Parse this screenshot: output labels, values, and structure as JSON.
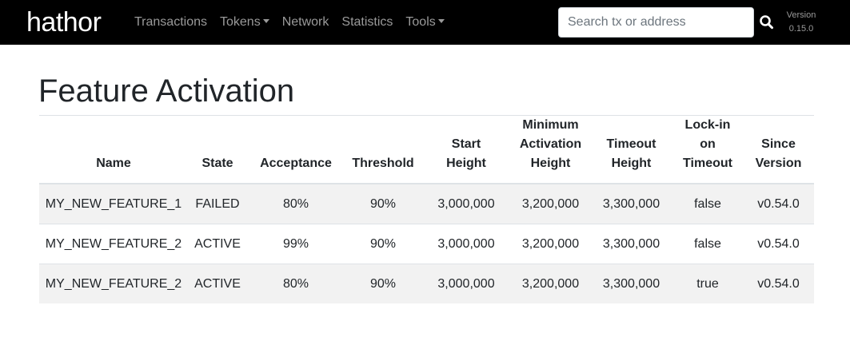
{
  "navbar": {
    "logo_text": "hathor",
    "links": [
      {
        "label": "Transactions",
        "dropdown": false
      },
      {
        "label": "Tokens",
        "dropdown": true
      },
      {
        "label": "Network",
        "dropdown": false
      },
      {
        "label": "Statistics",
        "dropdown": false
      },
      {
        "label": "Tools",
        "dropdown": true
      }
    ],
    "search": {
      "placeholder": "Search tx or address",
      "value": "",
      "icon": "search-icon"
    },
    "version_label": "Version",
    "version_value": "0.15.0"
  },
  "page": {
    "title": "Feature Activation"
  },
  "table": {
    "headers": {
      "name": "Name",
      "state": "State",
      "acceptance": "Acceptance",
      "threshold": "Threshold",
      "start_height": [
        "Start",
        "Height"
      ],
      "min_activation_height": [
        "Minimum",
        "Activation",
        "Height"
      ],
      "timeout_height": [
        "Timeout",
        "Height"
      ],
      "lock_in": [
        "Lock-in",
        "on",
        "Timeout"
      ],
      "since_version": [
        "Since",
        "Version"
      ]
    },
    "rows": [
      {
        "name": "MY_NEW_FEATURE_1",
        "state": "FAILED",
        "acceptance": "80%",
        "threshold": "90%",
        "start_height": "3,000,000",
        "min_activation_height": "3,200,000",
        "timeout_height": "3,300,000",
        "lock_in": "false",
        "since_version": "v0.54.0"
      },
      {
        "name": "MY_NEW_FEATURE_2",
        "state": "ACTIVE",
        "acceptance": "99%",
        "threshold": "90%",
        "start_height": "3,000,000",
        "min_activation_height": "3,200,000",
        "timeout_height": "3,300,000",
        "lock_in": "false",
        "since_version": "v0.54.0"
      },
      {
        "name": "MY_NEW_FEATURE_2",
        "state": "ACTIVE",
        "acceptance": "80%",
        "threshold": "90%",
        "start_height": "3,000,000",
        "min_activation_height": "3,200,000",
        "timeout_height": "3,300,000",
        "lock_in": "true",
        "since_version": "v0.54.0"
      }
    ]
  },
  "colors": {
    "navbar_bg": "#000000",
    "nav_link": "#9a9a9a",
    "striped_row": "#f2f2f2"
  }
}
